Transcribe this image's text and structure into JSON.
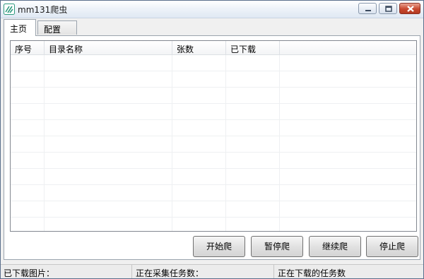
{
  "window": {
    "title": "mm131爬虫"
  },
  "tabs": [
    {
      "label": "主页",
      "active": true
    },
    {
      "label": "配置",
      "active": false
    }
  ],
  "table": {
    "columns": [
      "序号",
      "目录名称",
      "张数",
      "已下载"
    ],
    "rows": []
  },
  "buttons": {
    "start": "开始爬",
    "pause": "暂停爬",
    "resume": "继续爬",
    "stop": "停止爬"
  },
  "status": {
    "downloaded": "已下载图片：",
    "collecting": "正在采集任务数：",
    "downloading": "正在下载的任务数"
  },
  "icons": {
    "app": "app-logo-icon",
    "minimize": "minimize-icon",
    "maximize": "maximize-icon",
    "close": "close-icon"
  },
  "colors": {
    "close_button": "#c9482f",
    "app_icon": "#2e9a7e"
  }
}
